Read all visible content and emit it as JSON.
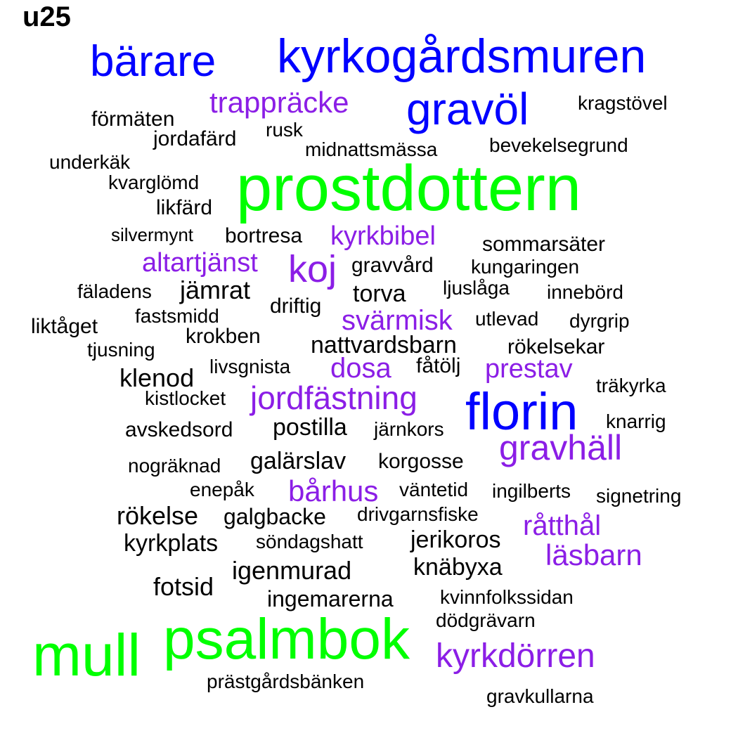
{
  "title": "u25",
  "colors": {
    "black": "#000000",
    "blue": "#0000ff",
    "green": "#00ff00",
    "purple": "#8b1ee6"
  },
  "words": [
    {
      "text": "bärare",
      "color": "blue"
    },
    {
      "text": "kyrkogårdsmuren",
      "color": "blue"
    },
    {
      "text": "trappräcke",
      "color": "purple"
    },
    {
      "text": "gravöl",
      "color": "blue"
    },
    {
      "text": "kragstövel",
      "color": "black"
    },
    {
      "text": "förmäten",
      "color": "black"
    },
    {
      "text": "rusk",
      "color": "black"
    },
    {
      "text": "jordafärd",
      "color": "black"
    },
    {
      "text": "bevekelsegrund",
      "color": "black"
    },
    {
      "text": "midnattsmässa",
      "color": "black"
    },
    {
      "text": "underkäk",
      "color": "black"
    },
    {
      "text": "kvarglömd",
      "color": "black"
    },
    {
      "text": "prostdottern",
      "color": "green"
    },
    {
      "text": "likfärd",
      "color": "black"
    },
    {
      "text": "silvermynt",
      "color": "black"
    },
    {
      "text": "bortresa",
      "color": "black"
    },
    {
      "text": "kyrkbibel",
      "color": "purple"
    },
    {
      "text": "sommarsäter",
      "color": "black"
    },
    {
      "text": "altartjänst",
      "color": "purple"
    },
    {
      "text": "koj",
      "color": "purple"
    },
    {
      "text": "gravvård",
      "color": "black"
    },
    {
      "text": "kungaringen",
      "color": "black"
    },
    {
      "text": "fäladens",
      "color": "black"
    },
    {
      "text": "jämrat",
      "color": "black"
    },
    {
      "text": "torva",
      "color": "black"
    },
    {
      "text": "ljuslåga",
      "color": "black"
    },
    {
      "text": "innebörd",
      "color": "black"
    },
    {
      "text": "driftig",
      "color": "black"
    },
    {
      "text": "fastsmidd",
      "color": "black"
    },
    {
      "text": "svärmisk",
      "color": "purple"
    },
    {
      "text": "utlevad",
      "color": "black"
    },
    {
      "text": "dyrgrip",
      "color": "black"
    },
    {
      "text": "liktåget",
      "color": "black"
    },
    {
      "text": "krokben",
      "color": "black"
    },
    {
      "text": "nattvardsbarn",
      "color": "black"
    },
    {
      "text": "rökelsekar",
      "color": "black"
    },
    {
      "text": "tjusning",
      "color": "black"
    },
    {
      "text": "livsgnista",
      "color": "black"
    },
    {
      "text": "dosa",
      "color": "purple"
    },
    {
      "text": "fåtölj",
      "color": "black"
    },
    {
      "text": "prestav",
      "color": "purple"
    },
    {
      "text": "klenod",
      "color": "black"
    },
    {
      "text": "träkyrka",
      "color": "black"
    },
    {
      "text": "kistlocket",
      "color": "black"
    },
    {
      "text": "jordfästning",
      "color": "purple"
    },
    {
      "text": "florin",
      "color": "blue"
    },
    {
      "text": "knarrig",
      "color": "black"
    },
    {
      "text": "avskedsord",
      "color": "black"
    },
    {
      "text": "postilla",
      "color": "black"
    },
    {
      "text": "järnkors",
      "color": "black"
    },
    {
      "text": "gravhäll",
      "color": "purple"
    },
    {
      "text": "nogräknad",
      "color": "black"
    },
    {
      "text": "galärslav",
      "color": "black"
    },
    {
      "text": "korgosse",
      "color": "black"
    },
    {
      "text": "enepåk",
      "color": "black"
    },
    {
      "text": "bårhus",
      "color": "purple"
    },
    {
      "text": "väntetid",
      "color": "black"
    },
    {
      "text": "ingilberts",
      "color": "black"
    },
    {
      "text": "signetring",
      "color": "black"
    },
    {
      "text": "rökelse",
      "color": "black"
    },
    {
      "text": "galgbacke",
      "color": "black"
    },
    {
      "text": "drivgarnsfiske",
      "color": "black"
    },
    {
      "text": "råtthål",
      "color": "purple"
    },
    {
      "text": "kyrkplats",
      "color": "black"
    },
    {
      "text": "söndagshatt",
      "color": "black"
    },
    {
      "text": "jerikoros",
      "color": "black"
    },
    {
      "text": "läsbarn",
      "color": "purple"
    },
    {
      "text": "igenmurad",
      "color": "black"
    },
    {
      "text": "knäbyxa",
      "color": "black"
    },
    {
      "text": "fotsid",
      "color": "black"
    },
    {
      "text": "ingemarerna",
      "color": "black"
    },
    {
      "text": "kvinnfolkssidan",
      "color": "black"
    },
    {
      "text": "dödgrävarn",
      "color": "black"
    },
    {
      "text": "mull",
      "color": "green"
    },
    {
      "text": "psalmbok",
      "color": "green"
    },
    {
      "text": "kyrkdörren",
      "color": "purple"
    },
    {
      "text": "prästgårdsbänken",
      "color": "black"
    },
    {
      "text": "gravkullarna",
      "color": "black"
    }
  ]
}
